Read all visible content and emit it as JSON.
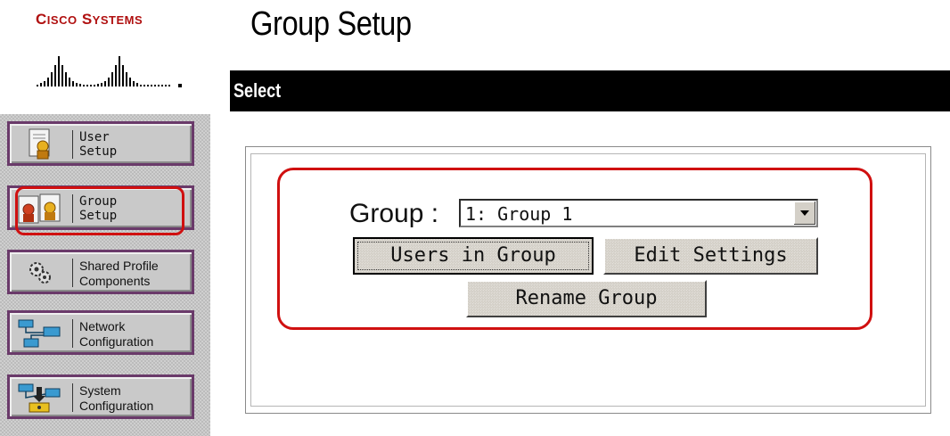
{
  "brand": {
    "name_first_cap": "C",
    "name_first_rest": "ISCO",
    "name_second_cap": "S",
    "name_second_rest": "YSTEMS"
  },
  "header": {
    "title": "Group Setup"
  },
  "section": {
    "title": "Select"
  },
  "nav": {
    "items": [
      {
        "label": "User\nSetup",
        "icon": "user-setup-icon"
      },
      {
        "label": "Group\nSetup",
        "icon": "group-setup-icon",
        "highlighted": true
      },
      {
        "label": "Shared Profile\nComponents",
        "icon": "shared-profile-icon"
      },
      {
        "label": "Network\nConfiguration",
        "icon": "network-config-icon"
      },
      {
        "label": "System\nConfiguration",
        "icon": "system-config-icon"
      }
    ]
  },
  "form": {
    "group_label": "Group :",
    "group_select_value": "1: Group 1",
    "users_in_group_label": "Users in Group",
    "edit_settings_label": "Edit Settings",
    "rename_group_label": "Rename Group"
  },
  "colors": {
    "brand_red": "#b01010",
    "highlight_red": "#d01010",
    "header_bar": "#000000",
    "nav_border": "#6a3a6a"
  }
}
